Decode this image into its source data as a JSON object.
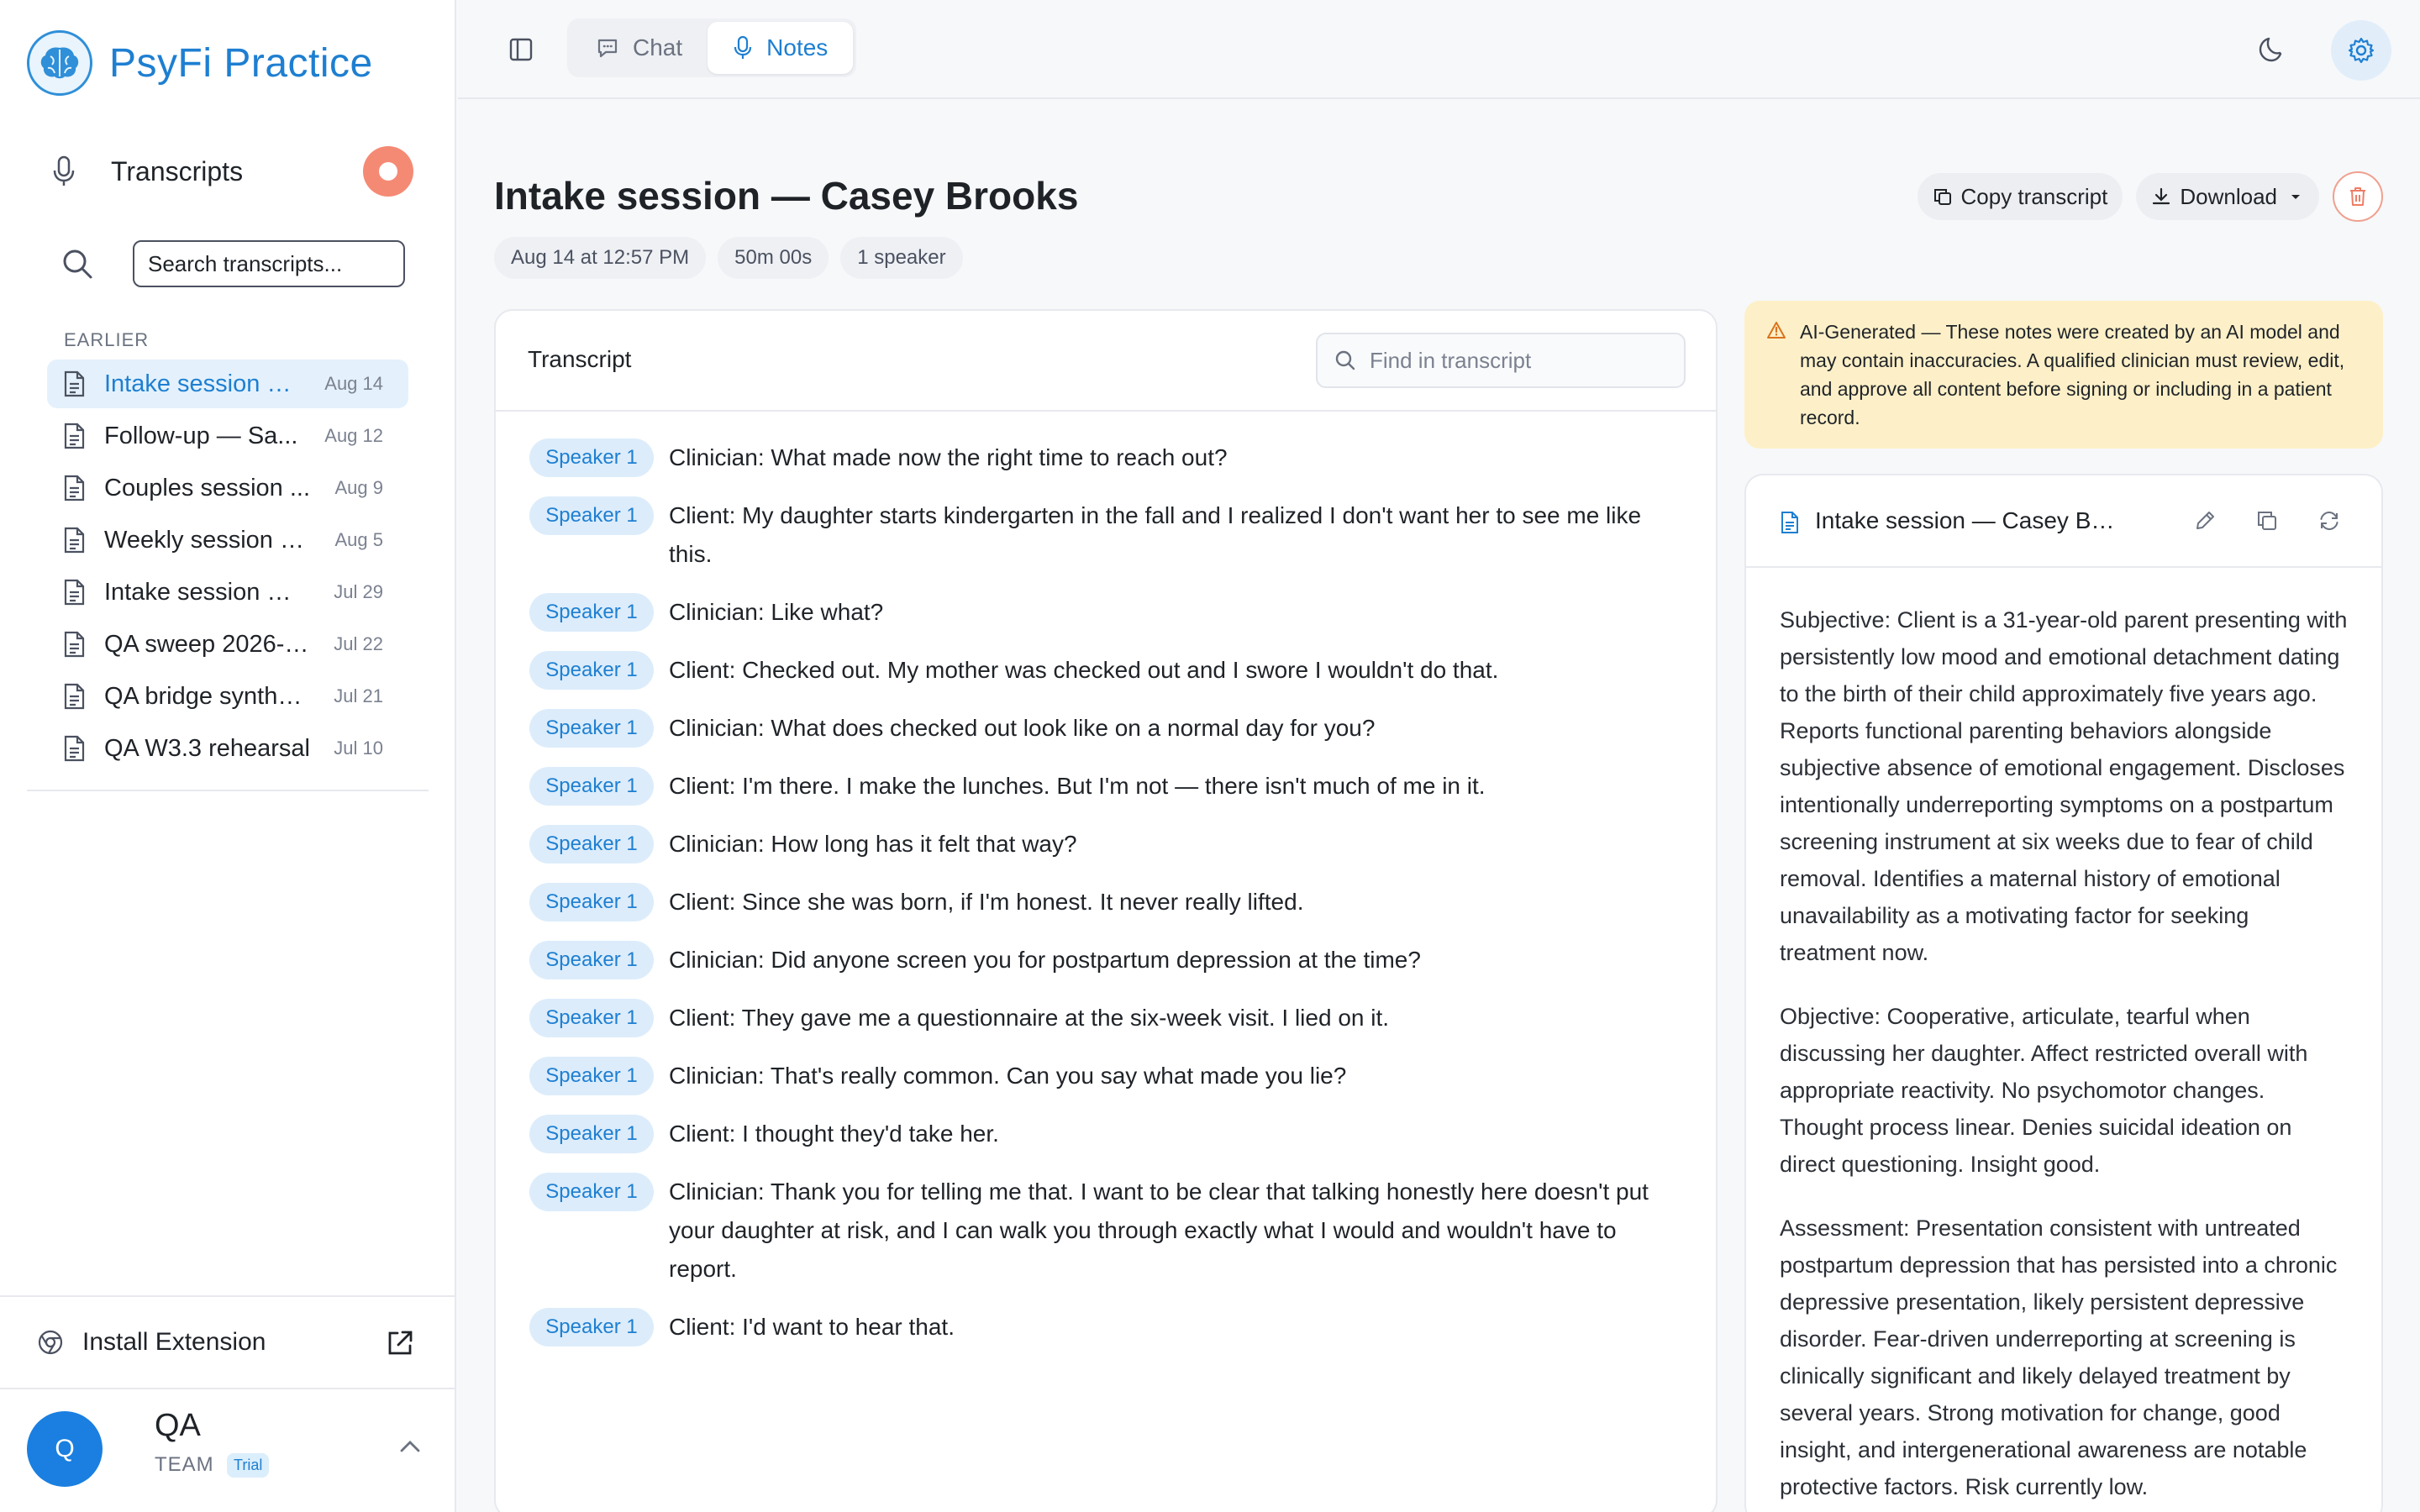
{
  "app": {
    "name": "PsyFi Practice"
  },
  "sidebar": {
    "transcripts_label": "Transcripts",
    "search_placeholder": "Search transcripts...",
    "section_label": "EARLIER",
    "items": [
      {
        "title": "Intake session — Casey Brooks",
        "date": "Aug 14",
        "active": true
      },
      {
        "title": "Follow-up — Sa...",
        "date": "Aug 12"
      },
      {
        "title": "Couples session ...",
        "date": "Aug 9"
      },
      {
        "title": "Weekly session —...",
        "date": "Aug 5"
      },
      {
        "title": "Intake session — J...",
        "date": "Jul 29"
      },
      {
        "title": "QA sweep 2026-0...",
        "date": "Jul 22"
      },
      {
        "title": "QA bridge synthet...",
        "date": "Jul 21"
      },
      {
        "title": "QA W3.3 rehearsal",
        "date": "Jul 10"
      }
    ],
    "install_label": "Install Extension",
    "account": {
      "initial": "Q",
      "name": "QA",
      "team": "TEAM",
      "badge": "Trial"
    }
  },
  "topbar": {
    "tabs": [
      {
        "label": "Chat"
      },
      {
        "label": "Notes",
        "active": true
      }
    ]
  },
  "session": {
    "title": "Intake session — Casey Brooks",
    "date": "Aug 14 at 12:57 PM",
    "duration": "50m 00s",
    "speakers": "1 speaker",
    "copy_label": "Copy transcript",
    "download_label": "Download"
  },
  "transcript": {
    "heading": "Transcript",
    "find_placeholder": "Find in transcript",
    "lines": [
      {
        "speaker": "Speaker 1",
        "text": "Clinician: What made now the right time to reach out?"
      },
      {
        "speaker": "Speaker 1",
        "text": "Client: My daughter starts kindergarten in the fall and I realized I don't want her to see me like this."
      },
      {
        "speaker": "Speaker 1",
        "text": "Clinician: Like what?"
      },
      {
        "speaker": "Speaker 1",
        "text": "Client: Checked out. My mother was checked out and I swore I wouldn't do that."
      },
      {
        "speaker": "Speaker 1",
        "text": "Clinician: What does checked out look like on a normal day for you?"
      },
      {
        "speaker": "Speaker 1",
        "text": "Client: I'm there. I make the lunches. But I'm not — there isn't much of me in it."
      },
      {
        "speaker": "Speaker 1",
        "text": "Clinician: How long has it felt that way?"
      },
      {
        "speaker": "Speaker 1",
        "text": "Client: Since she was born, if I'm honest. It never really lifted."
      },
      {
        "speaker": "Speaker 1",
        "text": "Clinician: Did anyone screen you for postpartum depression at the time?"
      },
      {
        "speaker": "Speaker 1",
        "text": "Client: They gave me a questionnaire at the six-week visit. I lied on it."
      },
      {
        "speaker": "Speaker 1",
        "text": "Clinician: That's really common. Can you say what made you lie?"
      },
      {
        "speaker": "Speaker 1",
        "text": "Client: I thought they'd take her."
      },
      {
        "speaker": "Speaker 1",
        "text": "Clinician: Thank you for telling me that. I want to be clear that talking honestly here doesn't put your daughter at risk, and I can walk you through exactly what I would and wouldn't have to report."
      },
      {
        "speaker": "Speaker 1",
        "text": "Client: I'd want to hear that."
      }
    ]
  },
  "notes": {
    "banner": "AI-Generated — These notes were created by an AI model and may contain inaccuracies. A qualified clinician must review, edit, and approve all content before signing or including in a patient record.",
    "title": "Intake session — Casey Brooks · ...",
    "paragraphs": [
      "Subjective: Client is a 31-year-old parent presenting with persistently low mood and emotional detachment dating to the birth of their child approximately five years ago. Reports functional parenting behaviors alongside subjective absence of emotional engagement. Discloses intentionally underreporting symptoms on a postpartum screening instrument at six weeks due to fear of child removal. Identifies a maternal history of emotional unavailability as a motivating factor for seeking treatment now.",
      "Objective: Cooperative, articulate, tearful when discussing her daughter. Affect restricted overall with appropriate reactivity. No psychomotor changes. Thought process linear. Denies suicidal ideation on direct questioning. Insight good.",
      "Assessment: Presentation consistent with untreated postpartum depression that has persisted into a chronic depressive presentation, likely persistent depressive disorder. Fear-driven underreporting at screening is clinically significant and likely delayed treatment by several years. Strong motivation for change, good insight, and intergenerational awareness are notable protective factors. Risk currently low."
    ]
  },
  "colors": {
    "accent": "#1e7fd1",
    "record": "#f58a74",
    "banner": "#fdf0c8"
  }
}
